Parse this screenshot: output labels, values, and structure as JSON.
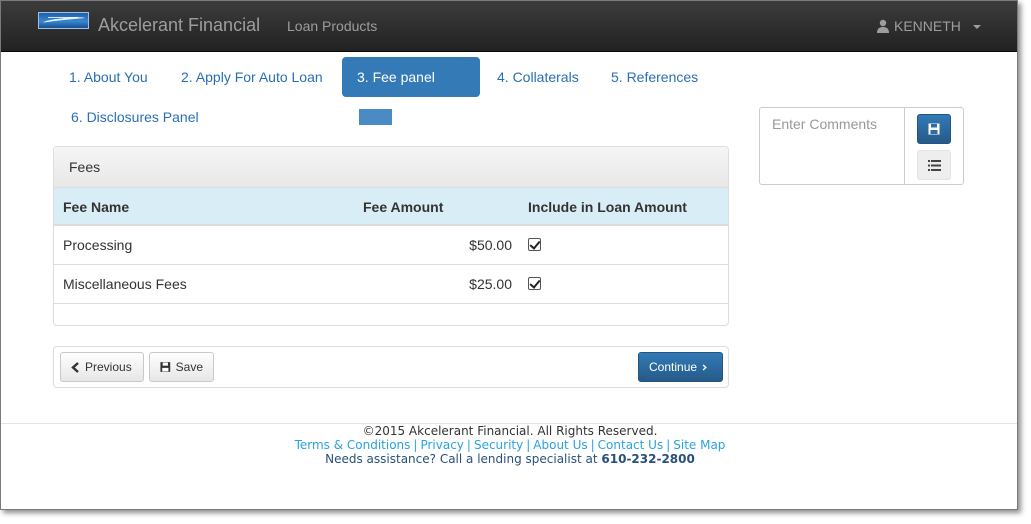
{
  "navbar": {
    "brand_title": "Akcelerant Financial",
    "nav_link": "Loan Products",
    "user_name": "KENNETH"
  },
  "tabs": [
    {
      "label": "1. About You"
    },
    {
      "label": "2. Apply For Auto Loan"
    },
    {
      "label": "3. Fee panel",
      "active": true
    },
    {
      "label": "4. Collaterals"
    },
    {
      "label": "5. References"
    },
    {
      "label": "6. Disclosures Panel"
    }
  ],
  "fees_panel": {
    "heading": "Fees",
    "columns": [
      "Fee Name",
      "Fee Amount",
      "Include in Loan Amount"
    ],
    "rows": [
      {
        "name": "Processing",
        "amount": "$50.00",
        "included": true
      },
      {
        "name": "Miscellaneous Fees",
        "amount": "$25.00",
        "included": true
      }
    ]
  },
  "buttons": {
    "previous": "Previous",
    "save": "Save",
    "continue": "Continue"
  },
  "comments": {
    "placeholder": "Enter Comments"
  },
  "footer": {
    "copyright": "©2015 Akcelerant Financial. All Rights Reserved.",
    "links": [
      "Terms & Conditions",
      "Privacy",
      "Security",
      "About Us",
      "Contact Us",
      "Site Map"
    ],
    "assist_text": "Needs assistance? Call a lending specialist at",
    "phone": "610-232-2800"
  },
  "colors": {
    "primary": "#337ab7",
    "navbar": "#222222",
    "table_header": "#d9edf7",
    "footer_link": "#2aa3dc"
  }
}
